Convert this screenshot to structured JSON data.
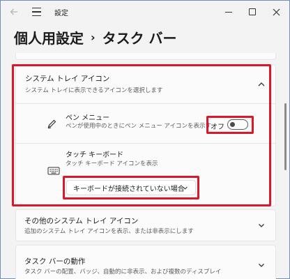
{
  "window": {
    "title": "設定"
  },
  "breadcrumb": {
    "parent": "個人用設定",
    "separator": "›",
    "current": "タスク バー"
  },
  "section": {
    "title": "システム トレイ アイコン",
    "subtitle": "システム トレイに表示できるアイコンを選択します",
    "items": [
      {
        "title": "ペン メニュー",
        "subtitle": "ペンが使用中のときにペン メニュー アイコンを表示す",
        "toggle_label": "オフ",
        "toggle_on": false
      },
      {
        "title": "タッチ キーボード",
        "subtitle": "タッチ キーボード アイコンを表示",
        "dropdown_value": "キーボードが接続されていない場合"
      }
    ]
  },
  "cards": [
    {
      "title": "その他のシステム トレイ アイコン",
      "subtitle": "追加のシステム トレイ アイコンを表示、または非表示にします"
    },
    {
      "title": "タスク バーの動作",
      "subtitle": "タスク バーの配置、バッジ、自動的に非表示、および複数のディスプレイ"
    }
  ],
  "colors": {
    "highlight": "#d9192b",
    "background": "#f3f3f3",
    "card": "#fbfbfb"
  }
}
